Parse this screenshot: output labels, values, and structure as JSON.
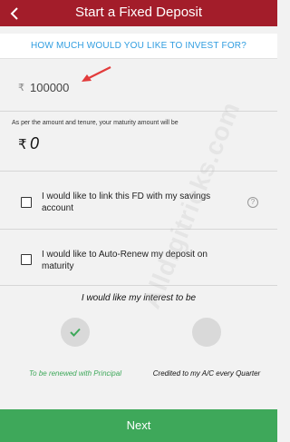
{
  "header": {
    "title": "Start a Fixed Deposit",
    "back_icon": "chevron-left-icon"
  },
  "question": {
    "text": "HOW MUCH WOULD YOU LIKE TO INVEST FOR?"
  },
  "amount": {
    "currency": "₹",
    "value": "100000"
  },
  "maturity": {
    "caption": "As per the amount and tenure, your maturity amount will be",
    "currency": "₹",
    "value": "0"
  },
  "options": [
    {
      "label": "I would like to link this FD with my savings account",
      "checked": false,
      "help_icon": "?"
    },
    {
      "label": "I would like to Auto-Renew my deposit on maturity",
      "checked": false
    }
  ],
  "interest": {
    "title": "I would like my interest to be",
    "choices": [
      {
        "label": "To be renewed with Principal",
        "selected": true,
        "icon": "check-icon"
      },
      {
        "label": "Credited to my A/C every Quarter",
        "selected": false
      }
    ]
  },
  "watermark": "Alldigitricks.com",
  "footer": {
    "next_label": "Next"
  },
  "colors": {
    "header_bg": "#a31d2a",
    "question_text": "#2f9de0",
    "next_bg": "#3ea85a",
    "selected_green": "#3ea85a",
    "annotation_arrow": "#e23b3b"
  }
}
